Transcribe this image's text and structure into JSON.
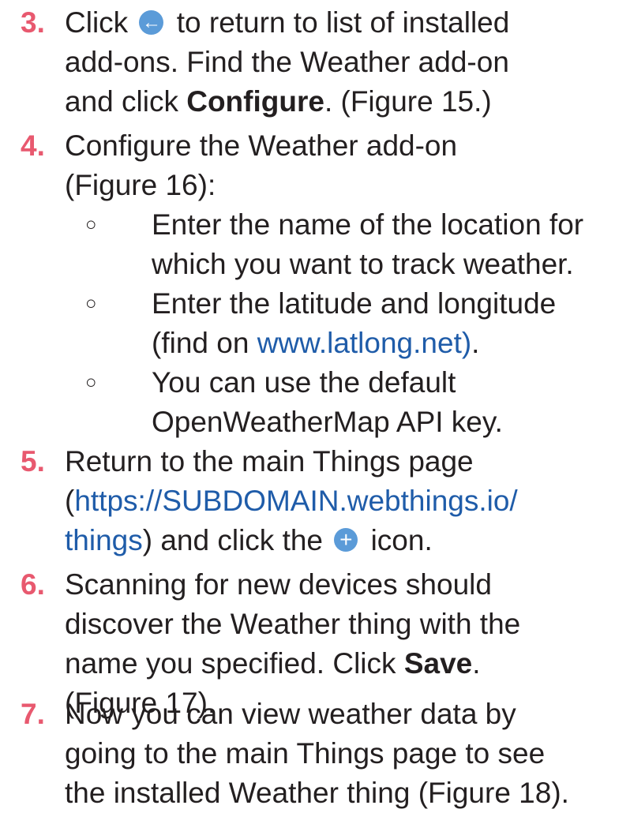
{
  "steps": [
    {
      "number": "3.",
      "line1_pre": "Click",
      "back_icon": "arrow-left-icon",
      "line1_post": "to return to list of installed",
      "line2": "add-ons. Find the Weather add-on",
      "line3_pre": "and click",
      "line3_bold": "Configure",
      "line3_post": ". (Figure 15.)"
    },
    {
      "number": "4.",
      "line1": "Configure the Weather add-on",
      "line2": "(Figure 16):",
      "bullet": "○",
      "sub": [
        {
          "line1": "Enter the name of the location for",
          "line2": "which you want to track weather."
        },
        {
          "line1": "Enter the latitude and longitude",
          "line2_pre": "(find on ",
          "line2_link": "www.latlong.net)",
          "line2_post": "."
        },
        {
          "line1": "You can use the default",
          "line2": "OpenWeatherMap API key."
        }
      ]
    },
    {
      "number": "5.",
      "line1": "Return to the main Things page",
      "line2_pre": "(",
      "line2_link": "https://SUBDOMAIN.webthings.io/",
      "line3_link": "things",
      "line3_mid": ") and click the",
      "plus_icon": "plus-icon",
      "line3_post": "icon."
    },
    {
      "number": "6.",
      "line1": "Scanning for new devices should",
      "line2": "discover the Weather thing with the",
      "line3_pre": "name you specified. Click",
      "line3_bold": "Save",
      "line3_post": ".",
      "line4": "(Figure 17)."
    },
    {
      "number": "7.",
      "line1": "Now you can view weather data by",
      "line2": "going to the main Things page to see",
      "line3": "the installed Weather thing (Figure 18)."
    }
  ],
  "colors": {
    "number": "#e8596f",
    "link": "#1f5ca9",
    "icon": "#5b9bd8"
  }
}
